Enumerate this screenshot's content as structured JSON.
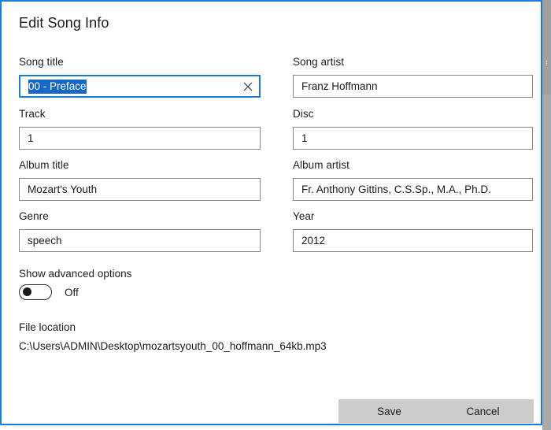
{
  "window": {
    "title": "Edit Song Info",
    "accent_color": "#1a7fd4",
    "border_color": "#1a7fd4",
    "background_color": "#ffffff",
    "selection_color": "#1668c8"
  },
  "form": {
    "song_title": {
      "label": "Song title",
      "value": "00 - Preface",
      "placeholder": "Song title",
      "focused": true,
      "selected": true,
      "clear_icon": "close-icon"
    },
    "song_artist": {
      "label": "Song artist",
      "value": "Franz  Hoffmann",
      "placeholder": "Song artist",
      "focused": false
    },
    "track": {
      "label": "Track",
      "value": "1",
      "placeholder": "Track",
      "focused": false
    },
    "disc": {
      "label": "Disc",
      "value": "1",
      "placeholder": "Disc",
      "focused": false
    },
    "album_title": {
      "label": "Album title",
      "value": "Mozart's Youth",
      "placeholder": "Album title",
      "focused": false
    },
    "album_artist": {
      "label": "Album artist",
      "value": "Fr. Anthony Gittins, C.S.Sp., M.A., Ph.D.",
      "placeholder": "Album artist",
      "focused": false
    },
    "genre": {
      "label": "Genre",
      "value": "speech",
      "placeholder": "Genre",
      "focused": false
    },
    "year": {
      "label": "Year",
      "value": "2012",
      "placeholder": "Year",
      "focused": false
    }
  },
  "advanced_options": {
    "label": "Show advanced options",
    "state_label": "Off",
    "checked": false
  },
  "file_location": {
    "label": "File location",
    "path": "C:\\Users\\ADMIN\\Desktop\\mozartsyouth_00_hoffmann_64kb.mp3"
  },
  "buttons": {
    "save": "Save",
    "cancel": "Cancel",
    "button_color": "#cccccc"
  }
}
